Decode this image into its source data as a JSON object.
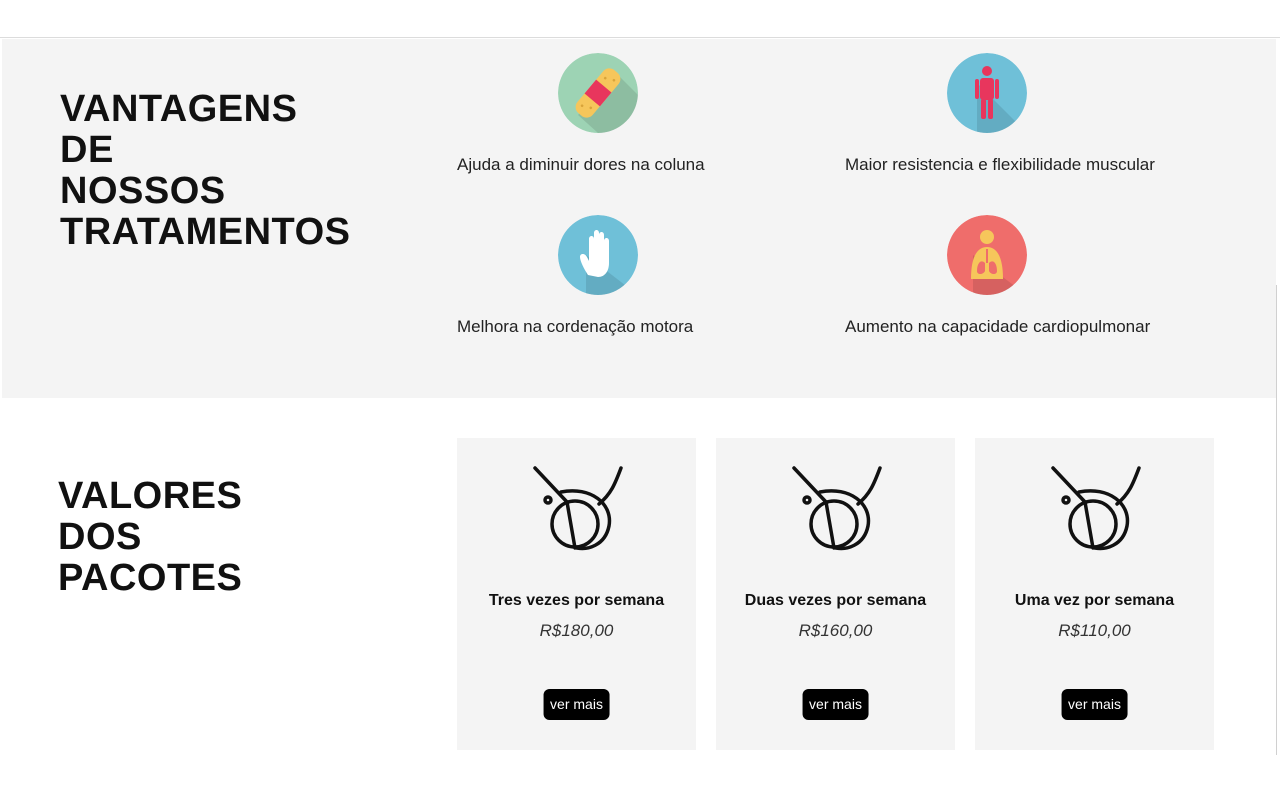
{
  "advantages": {
    "title": "VANTAGENS\nDE\nNOSSOS\nTRATAMENTOS",
    "items": [
      {
        "label": "Ajuda a diminuir dores na coluna",
        "icon": "bandage-icon",
        "color": "#9dd3b4"
      },
      {
        "label": "Maior resistencia e flexibilidade muscular",
        "icon": "person-icon",
        "color": "#6fc0d8"
      },
      {
        "label": "Melhora na cordenação motora",
        "icon": "hand-icon",
        "color": "#6fc0d8"
      },
      {
        "label": "Aumento na capacidade cardiopulmonar",
        "icon": "lungs-icon",
        "color": "#ef6d6b"
      }
    ]
  },
  "pricing": {
    "title": "VALORES\nDOS\nPACOTES",
    "plans": [
      {
        "name": "Tres vezes por semana",
        "price": "R$180,00",
        "button": "ver mais"
      },
      {
        "name": "Duas vezes por semana",
        "price": "R$160,00",
        "button": "ver mais"
      },
      {
        "name": "Uma vez por semana",
        "price": "R$110,00",
        "button": "ver mais"
      }
    ]
  },
  "colors": {
    "section_bg": "#f4f4f4",
    "button_bg": "#000000",
    "button_text": "#ffffff"
  }
}
